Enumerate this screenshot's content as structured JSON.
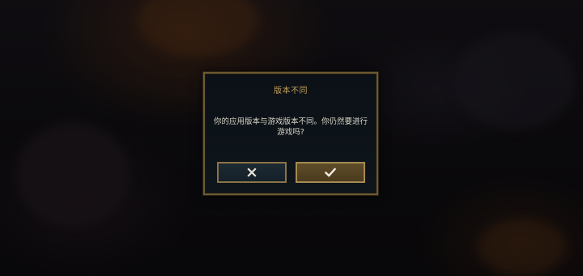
{
  "dialog": {
    "title": "版本不同",
    "message": "你的应用版本与游戏版本不同。你仍然要进行游戏吗?",
    "cancel_icon": "close-icon",
    "confirm_icon": "check-icon"
  },
  "colors": {
    "title_gold": "#c6a05a",
    "border_gold": "#6e5a30",
    "message_text": "#d9d4c7",
    "cancel_bg": "#1d2a32",
    "confirm_bg": "#5f4c28"
  }
}
